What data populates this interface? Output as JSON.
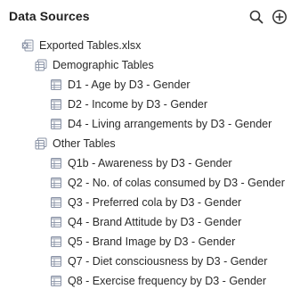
{
  "panel": {
    "title": "Data Sources"
  },
  "header_icons": {
    "search": "search-icon",
    "add": "add-circle-icon"
  },
  "tree": {
    "file": {
      "label": "Exported Tables.xlsx",
      "icon": "excel-file-icon"
    },
    "groups": [
      {
        "label": "Demographic Tables",
        "icon": "table-folder-icon",
        "tables": [
          "D1 - Age by D3 - Gender",
          "D2 - Income by D3 - Gender",
          "D4 - Living arrangements by D3 - Gender"
        ]
      },
      {
        "label": "Other Tables",
        "icon": "table-folder-icon",
        "tables": [
          "Q1b - Awareness by D3 - Gender",
          "Q2 - No. of colas consumed by D3 - Gender",
          "Q3 - Preferred cola by D3 - Gender",
          "Q4 - Brand Attitude by D3 - Gender",
          "Q5 - Brand Image by D3 - Gender",
          "Q7 - Diet consciousness by D3 - Gender",
          "Q8 - Exercise frequency by D3 - Gender"
        ]
      }
    ]
  },
  "colors": {
    "icon": "#8a93a6",
    "text": "#2a2a2a",
    "title": "#1f1f1f"
  }
}
